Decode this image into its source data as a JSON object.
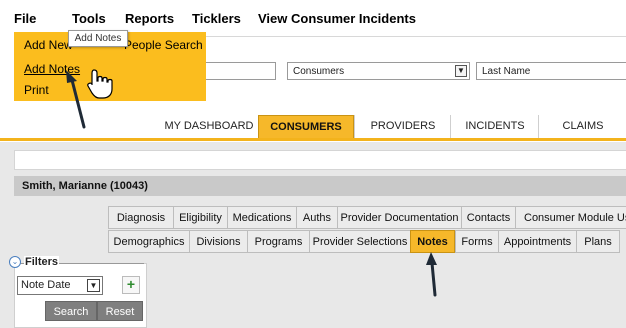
{
  "menubar": {
    "items": [
      "File",
      "Tools",
      "Reports",
      "Ticklers",
      "View Consumer Incidents"
    ]
  },
  "file_menu": {
    "items": [
      "Add New",
      "Add Notes",
      "Print"
    ],
    "behind_text": "People Search",
    "tooltip": "Add Notes"
  },
  "search": {
    "type_select": "Consumers",
    "field_select": "Last Name"
  },
  "main_tabs": {
    "items": [
      "MY DASHBOARD",
      "CONSUMERS",
      "PROVIDERS",
      "INCIDENTS",
      "CLAIMS"
    ],
    "active": "CONSUMERS"
  },
  "consumer": {
    "header": "Smith, Marianne (10043)"
  },
  "sub_tabs": {
    "row1": [
      "Diagnosis",
      "Eligibility",
      "Medications",
      "Auths",
      "Provider Documentation",
      "Contacts",
      "Consumer Module Use"
    ],
    "row2": [
      "Demographics",
      "Divisions",
      "Programs",
      "Provider Selections",
      "Notes",
      "Forms",
      "Appointments",
      "Plans"
    ],
    "active": "Notes"
  },
  "filters": {
    "title": "Filters",
    "select_value": "Note Date",
    "add_symbol": "+",
    "search_label": "Search",
    "reset_label": "Reset"
  },
  "colors": {
    "accent": "#f6b82a",
    "dropdown": "#fbbd1e",
    "button": "#7f7f7f"
  },
  "icons": {
    "cursor": "hand-pointer-icon",
    "add": "plus-icon",
    "toggle": "chevron-circle-icon"
  }
}
